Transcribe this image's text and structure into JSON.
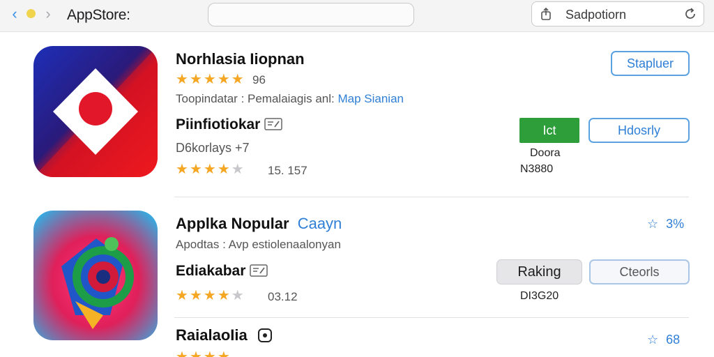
{
  "toolbar": {
    "title": "AppStore:",
    "search_text": "Sadpotiorn",
    "back_icon": "chevron-left-icon",
    "forward_icon": "chevron-right-icon",
    "share_icon": "share-icon",
    "reload_icon": "reload-icon"
  },
  "apps": [
    {
      "name": "Norhlasia Iiopnan",
      "stars": 5,
      "rating": "96",
      "desc": "Toopindatar : Pemalaiagis anl:",
      "desc_link": "Map Sianian",
      "sub_name": "Piinfiotiokar",
      "developer": "D6korlays +7",
      "stars_secondary": 4,
      "rating_secondary": "15. 157",
      "action_button": "Stapluer",
      "get_button": "Ict",
      "secondary_button": "Hdosrly",
      "size_label": "Doora",
      "price_label": "N3880"
    },
    {
      "name": "Applka Nopular",
      "category": "Caayn",
      "desc": "Apodtas : Avp estiolenaalonyan",
      "sub_name": "Ediakabar",
      "stars": 4,
      "rating": "03.12",
      "favorite": "3%",
      "primary_button": "Raking",
      "secondary_button": "Cteorls",
      "price_label": "DI3G20"
    },
    {
      "name": "RaialaoIia",
      "favorite": "68"
    }
  ],
  "colors": {
    "accent": "#2f7fd6",
    "star": "#f5a623",
    "get_button": "#2e9e3a"
  }
}
